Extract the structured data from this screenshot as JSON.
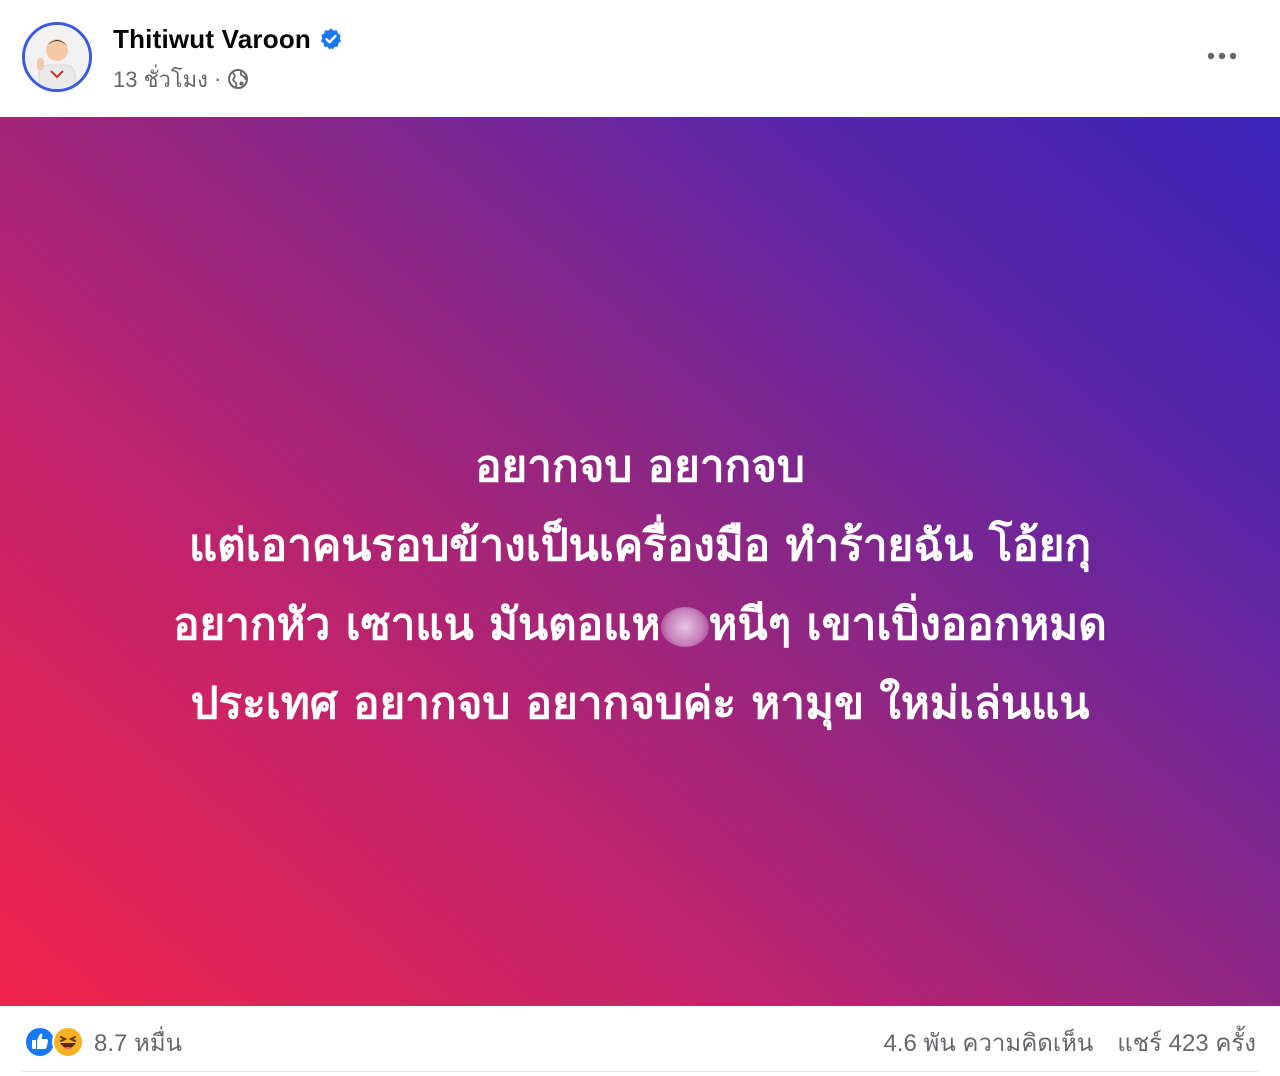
{
  "post": {
    "author": {
      "name": "Thitiwut Varoon",
      "verified": true
    },
    "meta": {
      "time": "13 ชั่วโมง",
      "separator": "·",
      "audience_icon": "globe-icon"
    },
    "more_icon": "more-horizontal-icon",
    "background": {
      "colors": [
        "#f1234a",
        "#8d2784",
        "#3a23b8"
      ]
    },
    "text_lines": [
      "อยากจบ อยากจบ",
      "แต่เอาคนรอบข้างเป็นเครื่องมือ ทำร้ายฉัน โอ้ยกุ",
      {
        "before": "อยากหัว เซาแน มันตอแห",
        "after": "หนีๆ เขาเบิ่งออกหมด"
      },
      "ประเทศ อยากจบ อยากจบค่ะ หามุข ใหม่เล่นแน"
    ],
    "reactions": {
      "icons": [
        "like-icon",
        "haha-icon"
      ],
      "count": "8.7 หมื่น"
    },
    "comments": "4.6 พัน ความคิดเห็น",
    "shares": "แชร์ 423 ครั้ง",
    "colors": {
      "verified": "#1877f2",
      "like": "#1877f2",
      "haha": "#f7b125",
      "secondary_text": "#65676b"
    }
  }
}
